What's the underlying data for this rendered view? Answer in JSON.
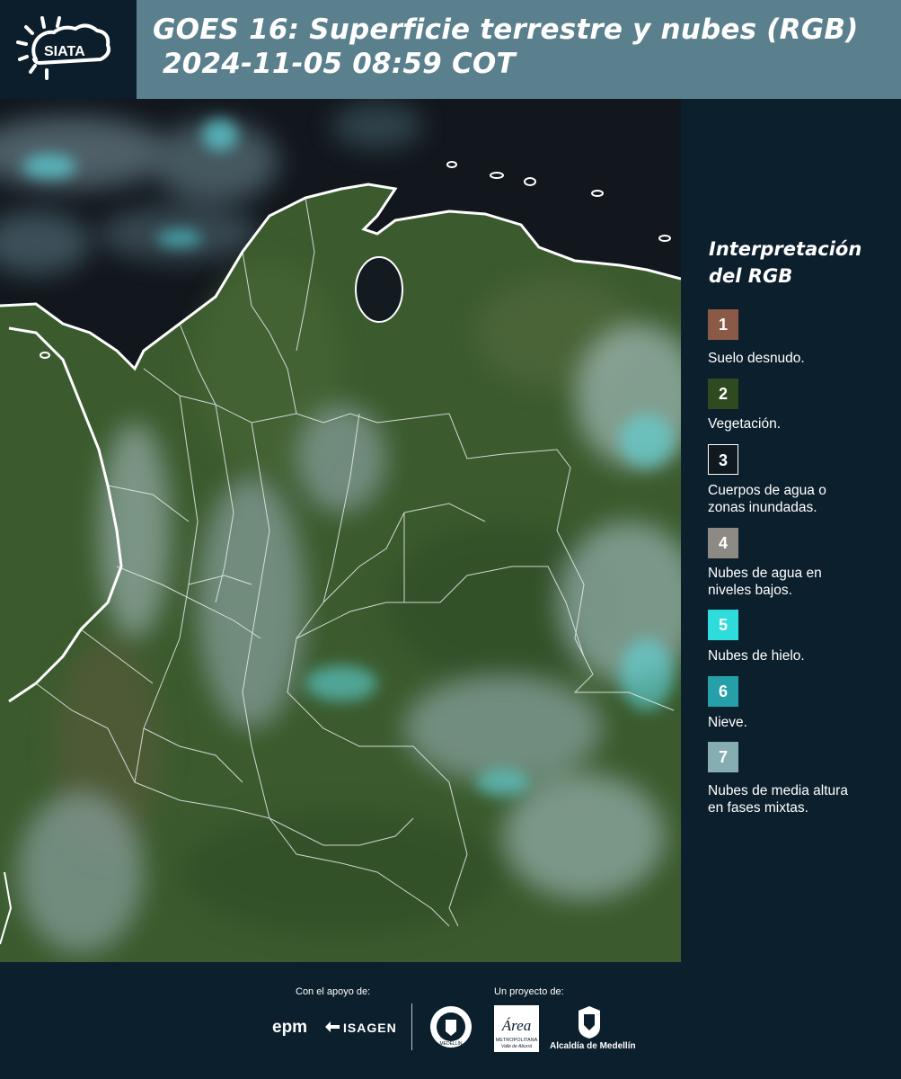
{
  "header": {
    "logo_text": "SIATA",
    "title_line1": "GOES 16: Superficie terrestre y nubes (RGB)",
    "title_line2": " 2024-11-05 08:59 COT"
  },
  "legend": {
    "title_line1": "Interpretación",
    "title_line2": "del RGB",
    "items": [
      {
        "num": "1",
        "color": "#8a5a47",
        "label_line1": "Suelo desnudo.",
        "label_line2": ""
      },
      {
        "num": "2",
        "color": "#2f4a1f",
        "label_line1": "Vegetación.",
        "label_line2": ""
      },
      {
        "num": "3",
        "color": "#101820",
        "label_line1": "Cuerpos de agua o",
        "label_line2": "zonas inundadas."
      },
      {
        "num": "4",
        "color": "#8c8a82",
        "label_line1": "Nubes de agua en",
        "label_line2": "niveles bajos."
      },
      {
        "num": "5",
        "color": "#2fdcdc",
        "label_line1": "Nubes de hielo.",
        "label_line2": ""
      },
      {
        "num": "6",
        "color": "#26a0a8",
        "label_line1": "Nieve.",
        "label_line2": ""
      },
      {
        "num": "7",
        "color": "#86aeb2",
        "label_line1": "Nubes de media altura",
        "label_line2": "en fases mixtas."
      }
    ]
  },
  "footer": {
    "support_label": "Con el apoyo de:",
    "project_label": "Un proyecto de:",
    "epm": "epm",
    "isagen": "ISAGEN",
    "area": "Área",
    "area_sub1": "METROPOLITANA",
    "area_sub2": "Valle de Aburrá",
    "alcaldia": "Alcaldía de Medellín",
    "seal": "MEDELLÍN"
  },
  "colors": {
    "header_bg": "#5a7f8d",
    "panel_bg": "#0c1f2d",
    "ocean": "#10161c",
    "land": "#3a5a2c",
    "cloud_ice": "#5fd6dc",
    "border": "#ffffff"
  }
}
